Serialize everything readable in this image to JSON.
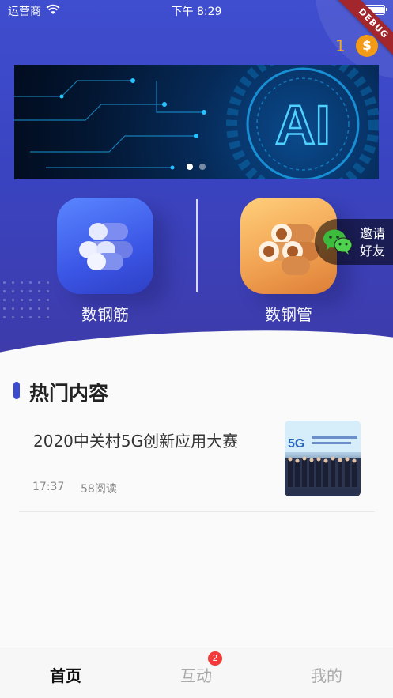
{
  "status_bar": {
    "carrier": "运营商",
    "time": "下午 8:29"
  },
  "debug_label": "DEBUG",
  "coins": {
    "count": "1",
    "icon": "$"
  },
  "banner": {
    "text": "AI",
    "dots_active": 0,
    "dots_count": 2
  },
  "categories": [
    {
      "label": "数钢筋",
      "icon": "rebar-icon"
    },
    {
      "label": "数钢管",
      "icon": "pipe-icon"
    }
  ],
  "invite": {
    "line1": "邀请",
    "line2": "好友"
  },
  "section": {
    "title": "热门内容"
  },
  "articles": [
    {
      "title": "2020中关村5G创新应用大赛",
      "time": "17:37",
      "reads": "58阅读",
      "thumb_text": "5G"
    }
  ],
  "tabs": [
    {
      "label": "首页",
      "active": true
    },
    {
      "label": "互动",
      "badge": "2"
    },
    {
      "label": "我的"
    }
  ],
  "colors": {
    "primary": "#3a4bd0",
    "accent": "#f39b16",
    "badge": "#f23a3a",
    "debug": "#a3262d"
  }
}
